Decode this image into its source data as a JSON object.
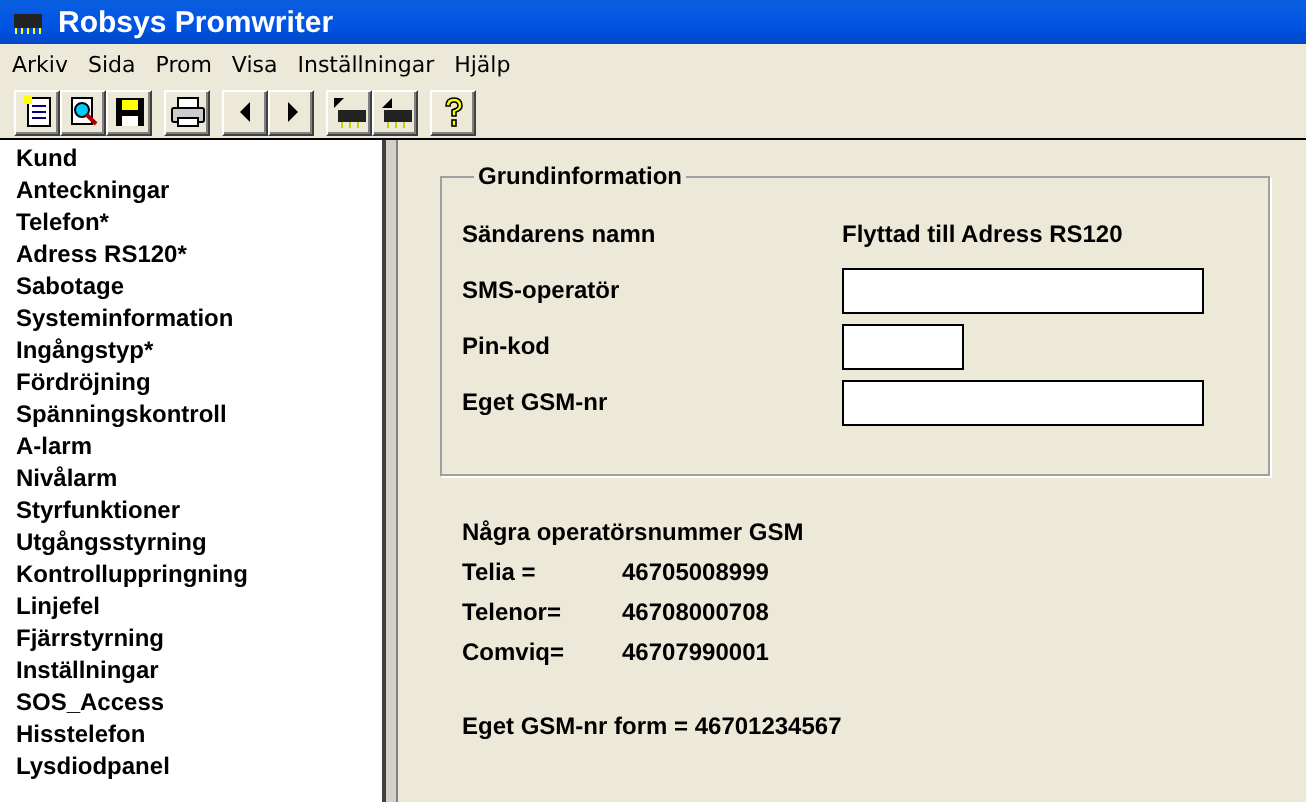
{
  "window": {
    "title": "Robsys Promwriter"
  },
  "menu": [
    "Arkiv",
    "Sida",
    "Prom",
    "Visa",
    "Inställningar",
    "Hjälp"
  ],
  "sidebar": {
    "items": [
      "Kund",
      "Anteckningar",
      "Telefon*",
      "Adress RS120*",
      "Sabotage",
      "Systeminformation",
      "Ingångstyp*",
      "Fördröjning",
      "Spänningskontroll",
      "A-larm",
      "Nivålarm",
      "Styrfunktioner",
      "Utgångsstyrning",
      "Kontrolluppringning",
      "Linjefel",
      "Fjärrstyrning",
      "Inställningar",
      "SOS_Access",
      "Hisstelefon",
      "Lysdiodpanel"
    ]
  },
  "group": {
    "title": "Grundinformation",
    "fields": [
      {
        "kind": "text",
        "label": "Sändarens namn",
        "value": "Flyttad till Adress RS120"
      },
      {
        "kind": "input",
        "label": "SMS-operatör"
      },
      {
        "kind": "short_input",
        "label": "Pin-kod"
      },
      {
        "kind": "input",
        "label": "Eget GSM-nr"
      }
    ]
  },
  "operators": {
    "heading": "Några operatörsnummer GSM",
    "rows": [
      {
        "name": "Telia =",
        "number": "46705008999"
      },
      {
        "name": "Telenor=",
        "number": "46708000708"
      },
      {
        "name": "Comviq=",
        "number": "46707990001"
      }
    ]
  },
  "format_note": "Eget GSM-nr form = 46701234567"
}
